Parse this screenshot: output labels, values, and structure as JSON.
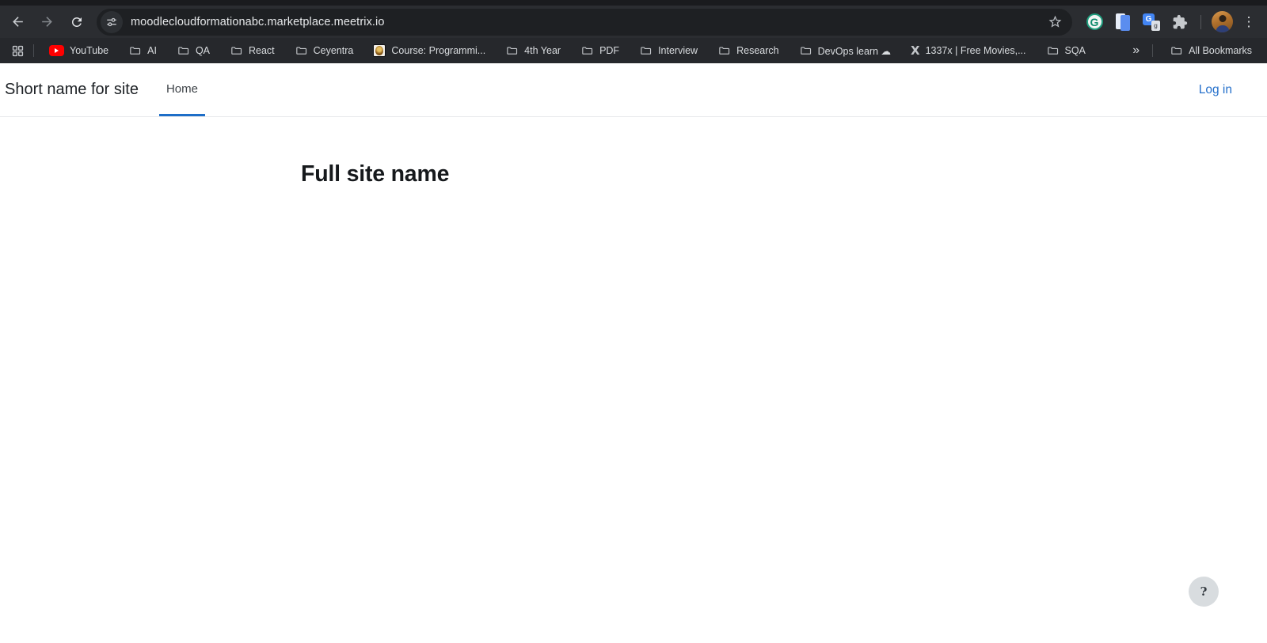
{
  "browser": {
    "toolbar": {
      "url": "moodlecloudformationabc.marketplace.meetrix.io",
      "menu_dots_glyph": "⋮",
      "grammarly_glyph": "G",
      "translate_glyph": "G",
      "translate_page_glyph": "g"
    },
    "bookmarks_bar": {
      "items": [
        {
          "label": "YouTube",
          "icon": "youtube-icon"
        },
        {
          "label": "AI",
          "icon": "folder-icon"
        },
        {
          "label": "QA",
          "icon": "folder-icon"
        },
        {
          "label": "React",
          "icon": "folder-icon"
        },
        {
          "label": "Ceyentra",
          "icon": "folder-icon"
        },
        {
          "label": "Course: Programmi...",
          "icon": "university-crest-favicon"
        },
        {
          "label": "4th Year",
          "icon": "folder-icon"
        },
        {
          "label": "PDF",
          "icon": "folder-icon"
        },
        {
          "label": "Interview",
          "icon": "folder-icon"
        },
        {
          "label": "Research",
          "icon": "folder-icon"
        },
        {
          "label": "DevOps learn ☁",
          "icon": "folder-icon"
        },
        {
          "label": "1337x | Free Movies,...",
          "icon": "x-site-favicon",
          "favicon_glyph": "X"
        },
        {
          "label": "SQA",
          "icon": "folder-icon"
        }
      ],
      "overflow_chevron": "»",
      "all_bookmarks_label": "All Bookmarks"
    }
  },
  "page": {
    "header": {
      "site_shortname": "Short name for site",
      "tabs": [
        {
          "label": "Home",
          "active": true
        }
      ],
      "login_label": "Log in"
    },
    "main": {
      "heading": "Full site name"
    },
    "help_button": {
      "glyph": "?"
    }
  },
  "colors": {
    "frame": "#1a1b1e",
    "toolbar_bg": "#2b2d31",
    "omnibox_bg": "#1e2023",
    "bookmarks_bg": "#26282c",
    "toolbar_text": "#e6e8ea",
    "bookmark_text": "#dadde0",
    "link_blue": "#2570cb",
    "tab_underline": "#1e6ec8",
    "youtube_red": "#ff0000",
    "x_favicon_orange": "#e8522a",
    "grammarly_green": "#1f9d7e",
    "translate_blue": "#4285f4",
    "page_bg": "#ffffff",
    "heading_text": "#16191c",
    "help_bg": "#d8dcdf"
  }
}
